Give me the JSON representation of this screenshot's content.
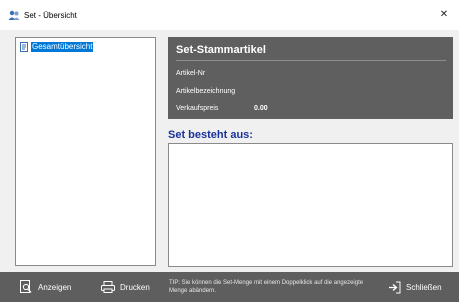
{
  "window": {
    "title": "Set - Übersicht",
    "close_glyph": "✕"
  },
  "tree": {
    "root_label": "Gesamtübersicht",
    "root_icon": "document-blue-icon",
    "selected_bg": "#0078d7"
  },
  "stammartikel": {
    "title": "Set-Stammartikel",
    "fields": [
      {
        "label": "Artikel-Nr",
        "value": ""
      },
      {
        "label": "Artikelbezeichnung",
        "value": ""
      },
      {
        "label": "Verkaufspreis",
        "value": "0.00"
      }
    ],
    "panel_color": "#5f5f5f"
  },
  "set": {
    "heading": "Set besteht aus:",
    "heading_color": "#1a3399",
    "items": []
  },
  "footer": {
    "buttons": {
      "anzeigen": {
        "label": "Anzeigen",
        "icon": "magnifier-document-icon"
      },
      "drucken": {
        "label": "Drucken",
        "icon": "printer-icon"
      },
      "schliessen": {
        "label": "Schließen",
        "icon": "exit-arrow-icon"
      }
    },
    "tip": "TIP: Sie können die Set-Menge mit einem Doppelklick auf die angezeigte Menge abändern.",
    "bar_color": "#5e5e5e"
  }
}
